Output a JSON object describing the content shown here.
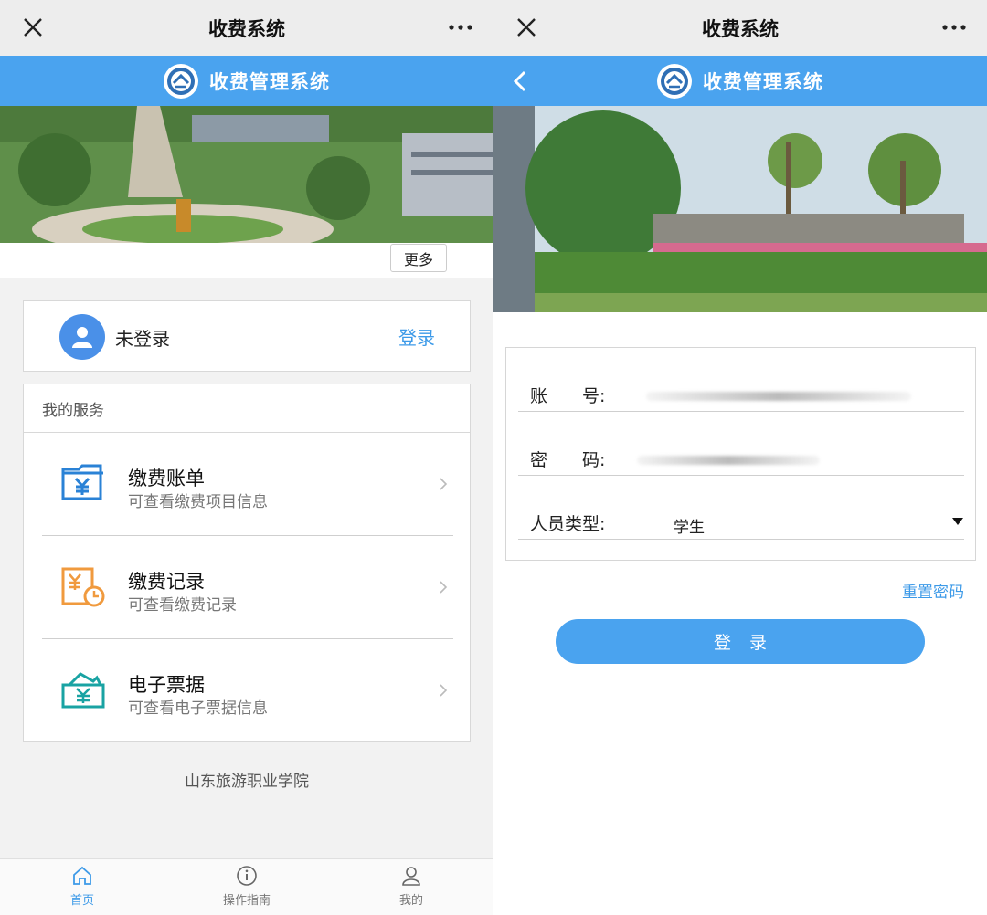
{
  "left": {
    "wx_title": "收费系统",
    "app_title": "收费管理系统",
    "more_label": "更多",
    "user": {
      "status": "未登录",
      "login_link": "登录"
    },
    "services": {
      "header": "我的服务",
      "items": [
        {
          "title": "缴费账单",
          "subtitle": "可查看缴费项目信息",
          "icon": "bill-icon"
        },
        {
          "title": "缴费记录",
          "subtitle": "可查看缴费记录",
          "icon": "record-icon"
        },
        {
          "title": "电子票据",
          "subtitle": "可查看电子票据信息",
          "icon": "receipt-icon"
        }
      ]
    },
    "footer": "山东旅游职业学院",
    "tabs": [
      {
        "label": "首页",
        "icon": "home-icon",
        "active": true
      },
      {
        "label": "操作指南",
        "icon": "info-icon",
        "active": false
      },
      {
        "label": "我的",
        "icon": "user-icon",
        "active": false
      }
    ]
  },
  "right": {
    "wx_title": "收费系统",
    "app_title": "收费管理系统",
    "form": {
      "account_label": "账　　号:",
      "password_label": "密　　码:",
      "type_label": "人员类型:",
      "type_value": "学生"
    },
    "reset_link": "重置密码",
    "login_button": "登录"
  },
  "colors": {
    "accent": "#4aa3ef",
    "link": "#3d9ae8",
    "wx_bar": "#ededed"
  }
}
